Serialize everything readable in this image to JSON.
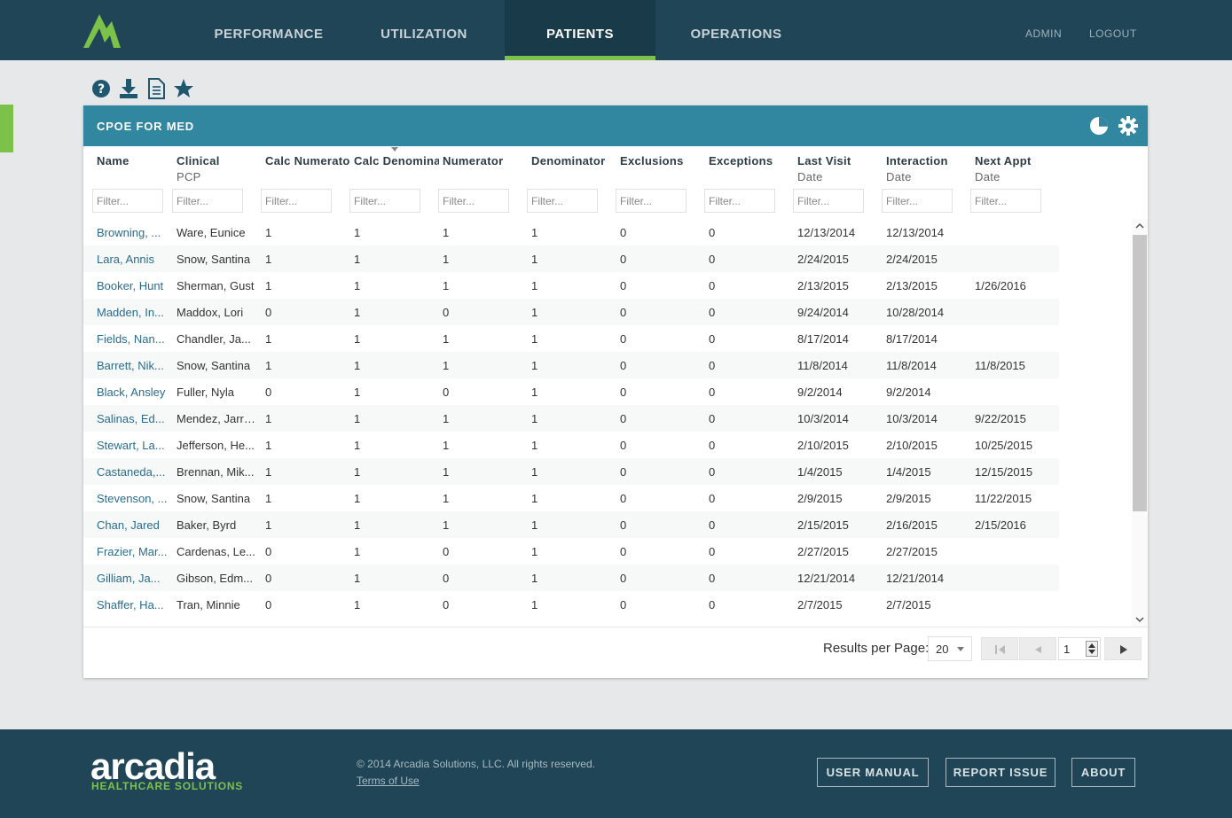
{
  "nav": {
    "items": [
      "PERFORMANCE",
      "UTILIZATION",
      "PATIENTS",
      "OPERATIONS"
    ],
    "active": "PATIENTS",
    "admin": "ADMIN",
    "logout": "LOGOUT"
  },
  "toolbar": {
    "icons": [
      "help-icon",
      "download-icon",
      "document-icon",
      "star-icon"
    ]
  },
  "panel": {
    "title": "CPOE FOR MED",
    "icons": [
      "pie-chart-icon",
      "gear-icon"
    ],
    "columns": [
      {
        "label": "Name",
        "sub": ""
      },
      {
        "label": "Clinical",
        "sub": "PCP"
      },
      {
        "label": "Calc Numerator",
        "sub": ""
      },
      {
        "label": "Calc Denominator",
        "sub": ""
      },
      {
        "label": "Numerator",
        "sub": ""
      },
      {
        "label": "Denominator",
        "sub": ""
      },
      {
        "label": "Exclusions",
        "sub": ""
      },
      {
        "label": "Exceptions",
        "sub": ""
      },
      {
        "label": "Last Visit",
        "sub": "Date"
      },
      {
        "label": "Interaction",
        "sub": "Date"
      },
      {
        "label": "Next Appt",
        "sub": "Date"
      }
    ],
    "filter_placeholder": "Filter...",
    "rows": [
      [
        "Browning, ...",
        "Ware, Eunice",
        "1",
        "1",
        "1",
        "1",
        "0",
        "0",
        "12/13/2014",
        "12/13/2014",
        ""
      ],
      [
        "Lara, Annis",
        "Snow, Santina",
        "1",
        "1",
        "1",
        "1",
        "0",
        "0",
        "2/24/2015",
        "2/24/2015",
        ""
      ],
      [
        "Booker, Hunt",
        "Sherman, Gust",
        "1",
        "1",
        "1",
        "1",
        "0",
        "0",
        "2/13/2015",
        "2/13/2015",
        "1/26/2016"
      ],
      [
        "Madden, In...",
        "Maddox, Lori",
        "0",
        "1",
        "0",
        "1",
        "0",
        "0",
        "9/24/2014",
        "10/28/2014",
        ""
      ],
      [
        "Fields, Nan...",
        "Chandler, Ja...",
        "1",
        "1",
        "1",
        "1",
        "0",
        "0",
        "8/17/2014",
        "8/17/2014",
        ""
      ],
      [
        "Barrett, Nik...",
        "Snow, Santina",
        "1",
        "1",
        "1",
        "1",
        "0",
        "0",
        "11/8/2014",
        "11/8/2014",
        "11/8/2015"
      ],
      [
        "Black, Ansley",
        "Fuller, Nyla",
        "0",
        "1",
        "0",
        "1",
        "0",
        "0",
        "9/2/2014",
        "9/2/2014",
        ""
      ],
      [
        "Salinas, Ed...",
        "Mendez, Jarrad",
        "1",
        "1",
        "1",
        "1",
        "0",
        "0",
        "10/3/2014",
        "10/3/2014",
        "9/22/2015"
      ],
      [
        "Stewart, La...",
        "Jefferson, He...",
        "1",
        "1",
        "1",
        "1",
        "0",
        "0",
        "2/10/2015",
        "2/10/2015",
        "10/25/2015"
      ],
      [
        "Castaneda,...",
        "Brennan, Mik...",
        "1",
        "1",
        "1",
        "1",
        "0",
        "0",
        "1/4/2015",
        "1/4/2015",
        "12/15/2015"
      ],
      [
        "Stevenson, ...",
        "Snow, Santina",
        "1",
        "1",
        "1",
        "1",
        "0",
        "0",
        "2/9/2015",
        "2/9/2015",
        "11/22/2015"
      ],
      [
        "Chan, Jared",
        "Baker, Byrd",
        "1",
        "1",
        "1",
        "1",
        "0",
        "0",
        "2/15/2015",
        "2/16/2015",
        "2/15/2016"
      ],
      [
        "Frazier, Mar...",
        "Cardenas, Le...",
        "0",
        "1",
        "0",
        "1",
        "0",
        "0",
        "2/27/2015",
        "2/27/2015",
        ""
      ],
      [
        "Gilliam, Ja...",
        "Gibson, Edm...",
        "0",
        "1",
        "0",
        "1",
        "0",
        "0",
        "12/21/2014",
        "12/21/2014",
        ""
      ],
      [
        "Shaffer, Ha...",
        "Tran, Minnie",
        "0",
        "1",
        "0",
        "1",
        "0",
        "0",
        "2/7/2015",
        "2/7/2015",
        ""
      ]
    ],
    "pager": {
      "results_label": "Results per Page:",
      "per_page": "20",
      "page": "1"
    }
  },
  "footer": {
    "logo": "arcadia",
    "logo_sub": "HEALTHCARE SOLUTIONS",
    "copyright": "© 2014 Arcadia Solutions, LLC. All rights reserved.",
    "terms": "Terms of Use",
    "buttons": [
      "USER MANUAL",
      "REPORT ISSUE",
      "ABOUT"
    ]
  },
  "colors": {
    "header_bg": "#1f4556",
    "panel_header": "#3186a0",
    "accent_green": "#7cc24a",
    "link": "#2a6c8e"
  }
}
